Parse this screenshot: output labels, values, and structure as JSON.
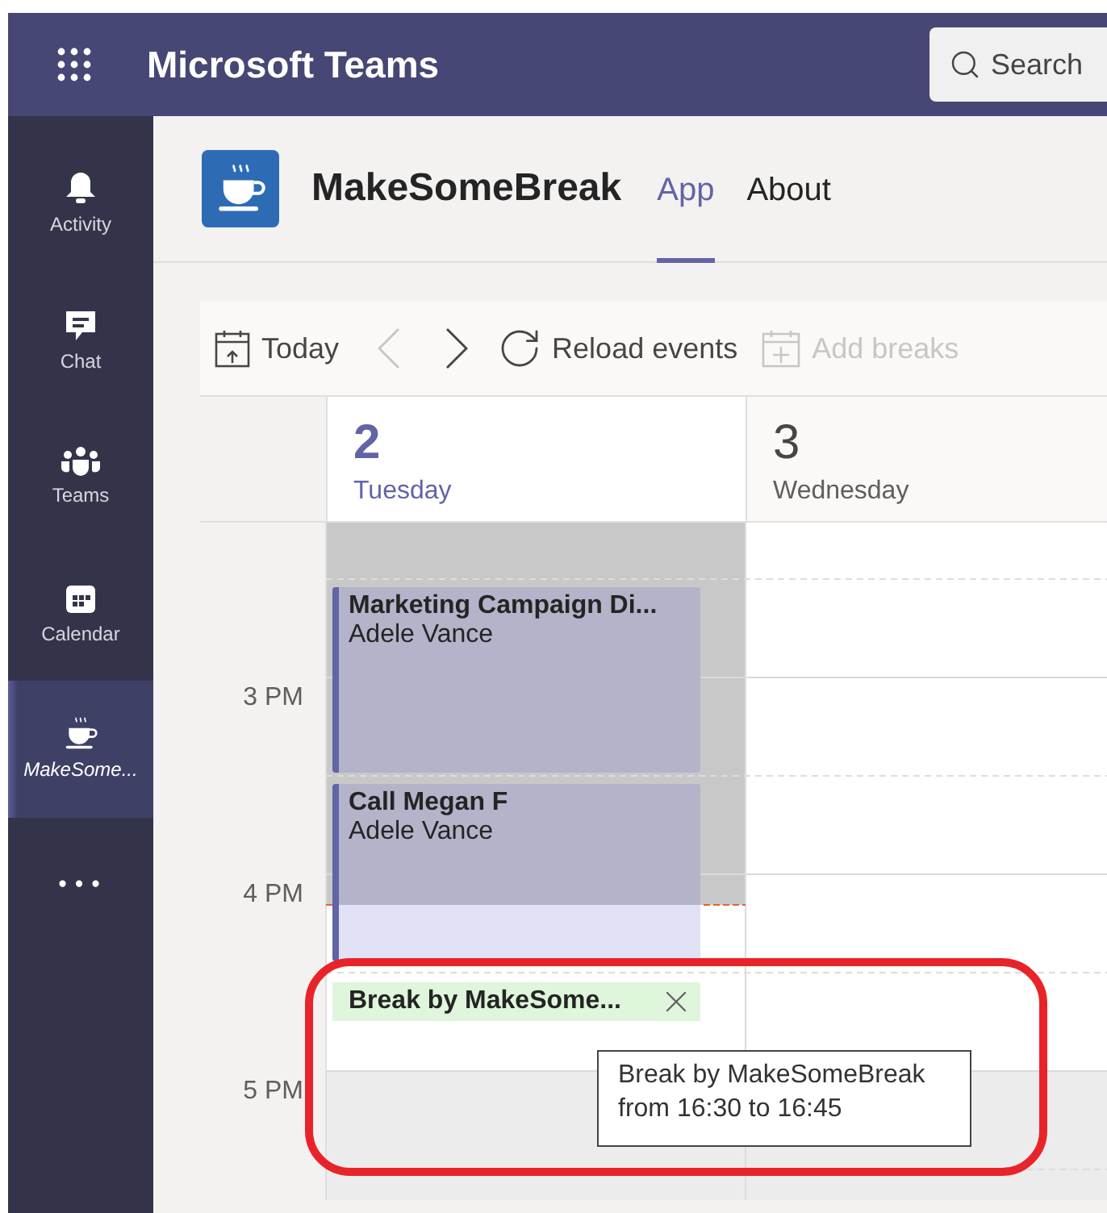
{
  "window": {
    "title": "Microsoft Teams"
  },
  "search": {
    "placeholder": "Search"
  },
  "rail": [
    {
      "label": "Activity",
      "kind": "bell",
      "selected": false
    },
    {
      "label": "Chat",
      "kind": "chat",
      "selected": false
    },
    {
      "label": "Teams",
      "kind": "teams",
      "selected": false
    },
    {
      "label": "Calendar",
      "kind": "calendar",
      "selected": false
    },
    {
      "label": "MakeSome...",
      "kind": "cup",
      "selected": true
    }
  ],
  "more_apps": "•••",
  "app": {
    "name": "MakeSomeBreak",
    "tabs": [
      {
        "label": "App",
        "selected": true
      },
      {
        "label": "About",
        "selected": false
      }
    ]
  },
  "toolbar": [
    {
      "label": "Today",
      "kind": "today",
      "disabled": false
    },
    {
      "kind": "prev",
      "disabled": true
    },
    {
      "kind": "next",
      "disabled": false
    },
    {
      "label": "Reload events",
      "kind": "reload",
      "disabled": false
    },
    {
      "label": "Add breaks",
      "kind": "add",
      "disabled": true
    }
  ],
  "days": [
    {
      "number": "2",
      "name": "Tuesday",
      "selected": true
    },
    {
      "number": "3",
      "name": "Wednesday",
      "selected": false
    }
  ],
  "hours": [
    "3 PM",
    "4 PM",
    "5 PM"
  ],
  "events": [
    {
      "kind": "meeting",
      "title": "Marketing Campaign Di...",
      "organizer": "Adele Vance"
    },
    {
      "kind": "meeting",
      "title": "Call Megan F",
      "organizer": "Adele Vance"
    },
    {
      "kind": "break",
      "title": "Break by MakeSome..."
    }
  ],
  "tooltip": {
    "lines": [
      "Break by MakeSomeBreak",
      "from 16:30 to 16:45"
    ]
  }
}
